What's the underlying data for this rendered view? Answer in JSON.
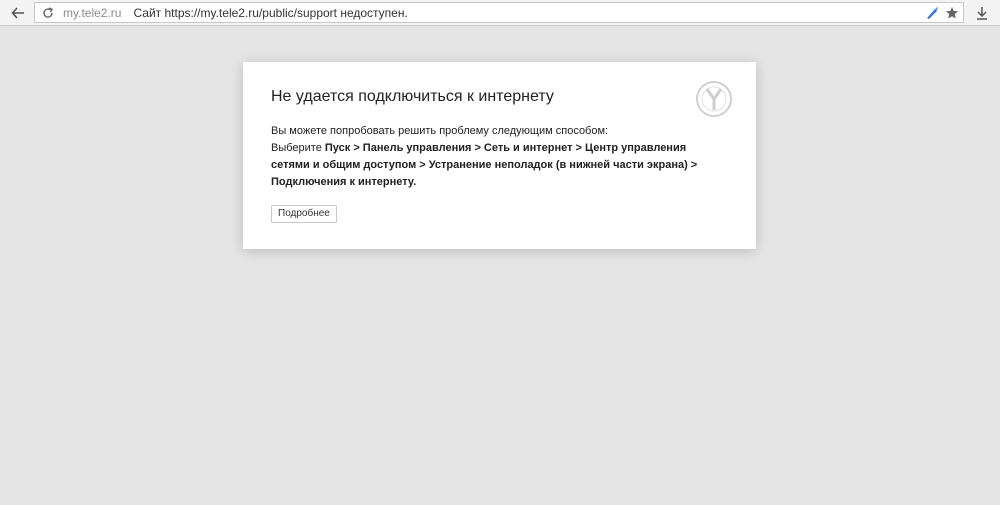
{
  "toolbar": {
    "host": "my.tele2.ru",
    "message": "Сайт https://my.tele2.ru/public/support недоступен."
  },
  "icons": {
    "back": "back-arrow-icon",
    "reload": "reload-icon",
    "protect": "protect-icon",
    "bookmark": "star-icon",
    "download": "download-icon",
    "browser_logo": "yandex-logo-icon"
  },
  "error": {
    "title": "Не удается подключиться к интернету",
    "line1": "Вы можете попробовать решить проблему следующим способом:",
    "line2_prefix": "Выберите ",
    "path_bold": "Пуск > Панель управления > Сеть и интернет > Центр управления сетями и общим доступом > Устранение неполадок (в нижней части экрана) > Подключения к интернету.",
    "more_button": "Подробнее"
  },
  "colors": {
    "background": "#e5e5e5",
    "card": "#ffffff",
    "protect_icon": "#3a78d4"
  }
}
